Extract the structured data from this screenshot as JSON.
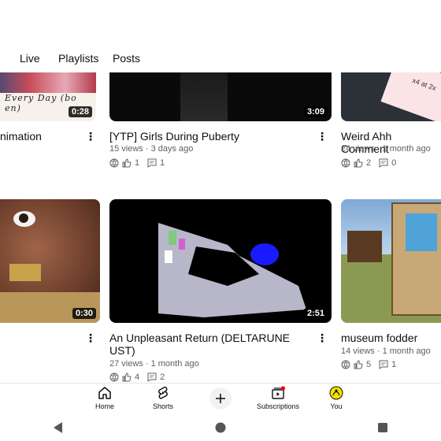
{
  "tabs": [
    "Live",
    "Playlists",
    "Posts"
  ],
  "videos": [
    {
      "thumb_caption": "Every Day (bo en)",
      "duration": "0:28",
      "title": "nimation"
    },
    {
      "duration": "3:09",
      "title": "[YTP] Girls During Puberty",
      "meta": "15 views · 3 days ago",
      "likes": "1",
      "comments": "1"
    },
    {
      "title": "Weird Ahh Comment",
      "meta": "24 views · 1 month ago",
      "likes": "2",
      "comments": "0",
      "thumb_text": "x4 at 2x"
    },
    {
      "duration": "0:30"
    },
    {
      "duration": "2:51",
      "title_line1": "An Unpleasant Return (DELTARUNE",
      "title_line2": "UST)",
      "meta": "27 views · 1 month ago",
      "likes": "4",
      "comments": "2"
    },
    {
      "title": "museum fodder",
      "meta": "14 views · 1 month ago",
      "likes": "5",
      "comments": "1"
    }
  ],
  "nav": {
    "home": "Home",
    "shorts": "Shorts",
    "subscriptions": "Subscriptions",
    "you": "You"
  },
  "colors": {
    "notification_dot": "#ff0000",
    "you_avatar": "#f5e000"
  }
}
